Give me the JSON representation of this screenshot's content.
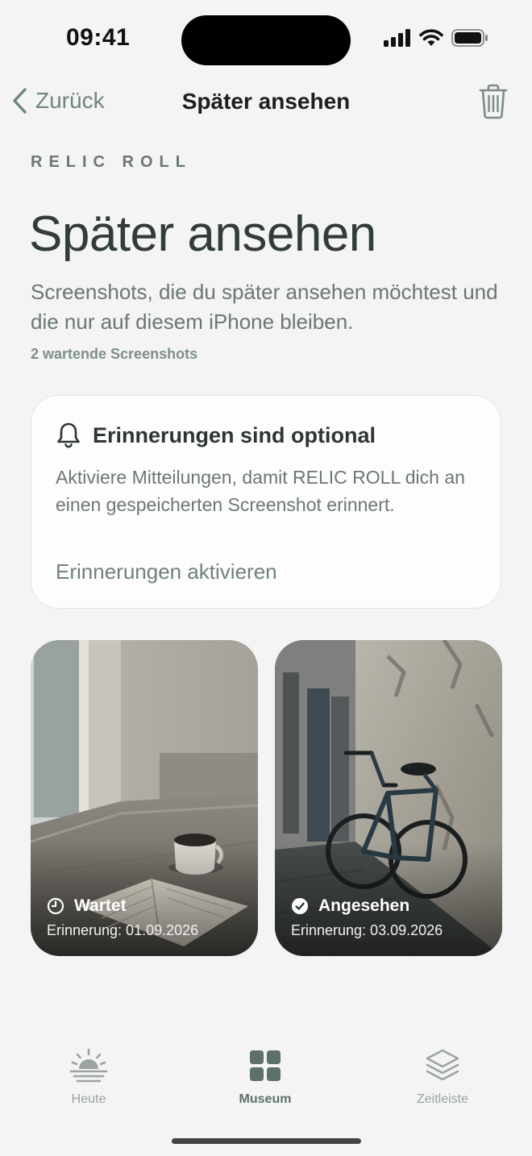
{
  "status_bar": {
    "time": "09:41"
  },
  "nav": {
    "back_label": "Zurück",
    "title": "Später ansehen"
  },
  "brand": "RELIC ROLL",
  "header": {
    "title": "Später ansehen",
    "subtitle": "Screenshots, die du später ansehen möchtest und die nur auf diesem iPhone bleiben.",
    "count": "2 wartende Screenshots"
  },
  "reminder_card": {
    "icon": "bell-icon",
    "title": "Erinnerungen sind optional",
    "body": "Aktiviere Mitteilungen, damit RELIC ROLL dich an einen gespeicherten Screenshot erinnert.",
    "action": "Erinnerungen aktivieren"
  },
  "screenshots": [
    {
      "status": "Wartet",
      "status_icon": "clock-icon",
      "reminder": "Erinnerung: 01.09.2026"
    },
    {
      "status": "Angesehen",
      "status_icon": "checkmark-circle-icon",
      "reminder": "Erinnerung: 03.09.2026"
    }
  ],
  "tabs": [
    {
      "label": "Heute",
      "icon": "sunrise-icon",
      "active": false
    },
    {
      "label": "Museum",
      "icon": "grid-icon",
      "active": true
    },
    {
      "label": "Zeitleiste",
      "icon": "layers-icon",
      "active": false
    }
  ],
  "colors": {
    "background": "#f3f4f3",
    "accent": "#5e706b",
    "muted": "#9ba4a2",
    "text": "#323d3b"
  }
}
